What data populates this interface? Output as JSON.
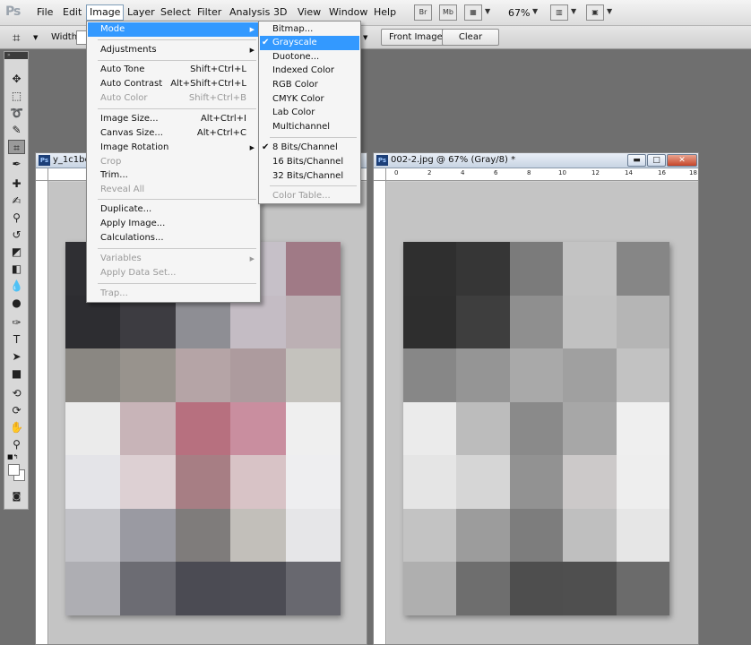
{
  "menubar": {
    "app_logo": "Ps",
    "items": [
      "File",
      "Edit",
      "Image",
      "Layer",
      "Select",
      "Filter",
      "Analysis",
      "3D",
      "View",
      "Window",
      "Help"
    ],
    "open_item": "Image",
    "bridge_button": "Br",
    "minibridge_button": "Mb",
    "zoom": "67%"
  },
  "options": {
    "width_label": "Width:",
    "front_image_button": "Front Image",
    "clear_button": "Clear"
  },
  "image_menu": {
    "mode": "Mode",
    "adjustments": "Adjustments",
    "auto_tone": {
      "label": "Auto Tone",
      "shortcut": "Shift+Ctrl+L"
    },
    "auto_contrast": {
      "label": "Auto Contrast",
      "shortcut": "Alt+Shift+Ctrl+L"
    },
    "auto_color": {
      "label": "Auto Color",
      "shortcut": "Shift+Ctrl+B"
    },
    "image_size": {
      "label": "Image Size...",
      "shortcut": "Alt+Ctrl+I"
    },
    "canvas_size": {
      "label": "Canvas Size...",
      "shortcut": "Alt+Ctrl+C"
    },
    "image_rotation": "Image Rotation",
    "crop": "Crop",
    "trim": "Trim...",
    "reveal_all": "Reveal All",
    "duplicate": "Duplicate...",
    "apply_image": "Apply Image...",
    "calculations": "Calculations...",
    "variables": "Variables",
    "apply_data_set": "Apply Data Set...",
    "trap": "Trap..."
  },
  "mode_menu": {
    "bitmap": "Bitmap...",
    "grayscale": "Grayscale",
    "duotone": "Duotone...",
    "indexed": "Indexed Color",
    "rgb": "RGB Color",
    "cmyk": "CMYK Color",
    "lab": "Lab Color",
    "multichannel": "Multichannel",
    "bits8": "8 Bits/Channel",
    "bits16": "16 Bits/Channel",
    "bits32": "32 Bits/Channel",
    "color_table": "Color Table..."
  },
  "doc_left": {
    "title": "y_1c1be"
  },
  "doc_right": {
    "title": "002-2.jpg @ 67% (Gray/8) *",
    "ruler_ticks": [
      "0",
      "2",
      "4",
      "6",
      "8",
      "10",
      "12",
      "14",
      "16",
      "18"
    ]
  },
  "color_image": [
    [
      "#2f2f33",
      "#35353a",
      "#7a7a82",
      "#c6c0c8",
      "#a07a86"
    ],
    [
      "#2d2d31",
      "#3d3c41",
      "#8e8e94",
      "#c4bcc4",
      "#bcb0b4"
    ],
    [
      "#8a8782",
      "#98938d",
      "#b5a4a6",
      "#ad9b9e",
      "#c4c2bd"
    ],
    [
      "#ebebeb",
      "#c8b4b8",
      "#b7707f",
      "#c98e9f",
      "#efefef"
    ],
    [
      "#e4e4e8",
      "#ddd0d3",
      "#a77e84",
      "#d8c3c6",
      "#eeeef0"
    ],
    [
      "#c2c2c7",
      "#9a9aa2",
      "#7f7c7b",
      "#c2bfba",
      "#e6e6e8"
    ],
    [
      "#aeaeb3",
      "#6c6c73",
      "#4b4b53",
      "#4c4c54",
      "#68686f"
    ]
  ],
  "gray_image": [
    [
      "#2f2f2f",
      "#363636",
      "#7b7b7b",
      "#c3c3c3",
      "#868686"
    ],
    [
      "#2e2e2e",
      "#3e3e3e",
      "#8f8f8f",
      "#c1c1c1",
      "#b5b5b5"
    ],
    [
      "#878787",
      "#959595",
      "#a9a9a9",
      "#a0a0a0",
      "#c2c2c2"
    ],
    [
      "#ebebeb",
      "#bcbcbc",
      "#8a8a8a",
      "#a7a7a7",
      "#efefef"
    ],
    [
      "#e5e5e5",
      "#d6d6d6",
      "#929292",
      "#ccc9c9",
      "#eeeeee"
    ],
    [
      "#c3c3c3",
      "#9c9c9c",
      "#7d7d7d",
      "#bfbfbf",
      "#e6e6e6"
    ],
    [
      "#afafaf",
      "#6e6e6e",
      "#4e4e4e",
      "#4f4f4f",
      "#6b6b6b"
    ]
  ]
}
